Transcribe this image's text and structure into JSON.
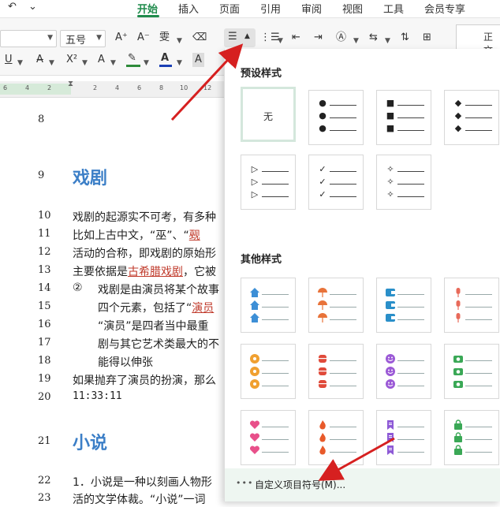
{
  "tabs": [
    {
      "label": "开始",
      "active": true
    },
    {
      "label": "插入"
    },
    {
      "label": "页面"
    },
    {
      "label": "引用"
    },
    {
      "label": "审阅"
    },
    {
      "label": "视图"
    },
    {
      "label": "工具"
    },
    {
      "label": "会员专享"
    }
  ],
  "toolbar": {
    "font_size": "五号",
    "grow_font": "A⁺",
    "shrink_font": "A⁻",
    "phonetic": "雯",
    "clear_format": "⌫",
    "underline": "U",
    "superscript": "X²",
    "text_effect": "A",
    "highlight_color": "#2e8b3a",
    "font_color": "#1a3fb5",
    "char_shade": "A",
    "style_preview": "正文"
  },
  "ruler": {
    "ticks": [
      "6",
      "4",
      "2",
      "2",
      "4",
      "6",
      "8",
      "10",
      "12"
    ]
  },
  "document": {
    "line_numbers": [
      "8",
      "9",
      "10",
      "11",
      "12",
      "13",
      "14",
      "15",
      "16",
      "17",
      "18",
      "19",
      "20",
      "21",
      "22",
      "23"
    ],
    "heading_drama": "戏剧",
    "line10": "戏剧的起源实不可考，有多种",
    "line11_a": "比如上古中文，“巫”、“",
    "line11_b": "觋",
    "line12": "活动的合称，即戏剧的原始形",
    "line13_a": "主要依据是",
    "line13_link": "古希腊戏剧",
    "line13_b": "，它被",
    "line14_num": "②",
    "line14": "戏剧是由演员将某个故事",
    "line15_a": "四个元素，包括了“",
    "line15_link": "演员",
    "line16": "“演员”是四者当中最重",
    "line17": "剧与其它艺术类最大的不",
    "line18": "能得以伸张",
    "line19": "如果抛弃了演员的扮演，那么",
    "line20": "11:33:11",
    "heading_novel": "小说",
    "line22": "1．小说是一种以刻画人物形",
    "line23": "活的文学体裁。“小说”一词"
  },
  "panel": {
    "preset_title": "预设样式",
    "none_label": "无",
    "preset_symbols": [
      "●",
      "■",
      "◆",
      "▷",
      "✓",
      "✧"
    ],
    "other_title": "其他样式",
    "other_icons": [
      {
        "name": "house-icon",
        "color": "#3d8fd6"
      },
      {
        "name": "umbrella-icon",
        "color": "#e8733a"
      },
      {
        "name": "wallet-icon",
        "color": "#2a8fc9"
      },
      {
        "name": "microphone-icon",
        "color": "#e86a5a"
      },
      {
        "name": "flower-icon",
        "color": "#f0a030"
      },
      {
        "name": "drum-icon",
        "color": "#e04a3a"
      },
      {
        "name": "smiley-icon",
        "color": "#9b59d6"
      },
      {
        "name": "camera-icon",
        "color": "#3aa856"
      },
      {
        "name": "heart-icon",
        "color": "#e8508a"
      },
      {
        "name": "flame-icon",
        "color": "#e85a2a"
      },
      {
        "name": "bookmark-icon",
        "color": "#8e5ad6"
      },
      {
        "name": "shopping-bag-icon",
        "color": "#3aa856"
      }
    ],
    "custom_label": "自定义项目符号(M)...",
    "more_dots": "•••"
  }
}
